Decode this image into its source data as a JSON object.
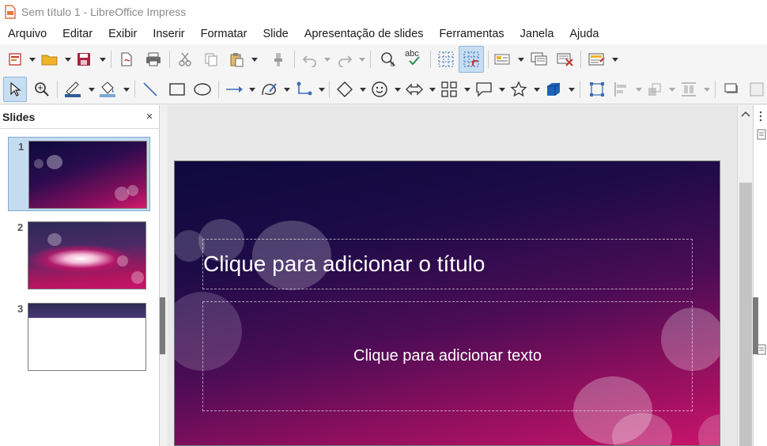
{
  "window": {
    "title": "Sem título 1 - LibreOffice Impress"
  },
  "menu": [
    "Arquivo",
    "Editar",
    "Exibir",
    "Inserir",
    "Formatar",
    "Slide",
    "Apresentação de slides",
    "Ferramentas",
    "Janela",
    "Ajuda"
  ],
  "slides_panel": {
    "title": "Slides",
    "close_glyph": "×",
    "slides": [
      "1",
      "2",
      "3"
    ]
  },
  "slide": {
    "title_placeholder": "Clique para adicionar o título",
    "body_placeholder": "Clique para adicionar texto"
  },
  "colors": {
    "accent": "#c8146a",
    "slide_dark": "#0d0a3d",
    "selection": "#c5dcf0"
  }
}
